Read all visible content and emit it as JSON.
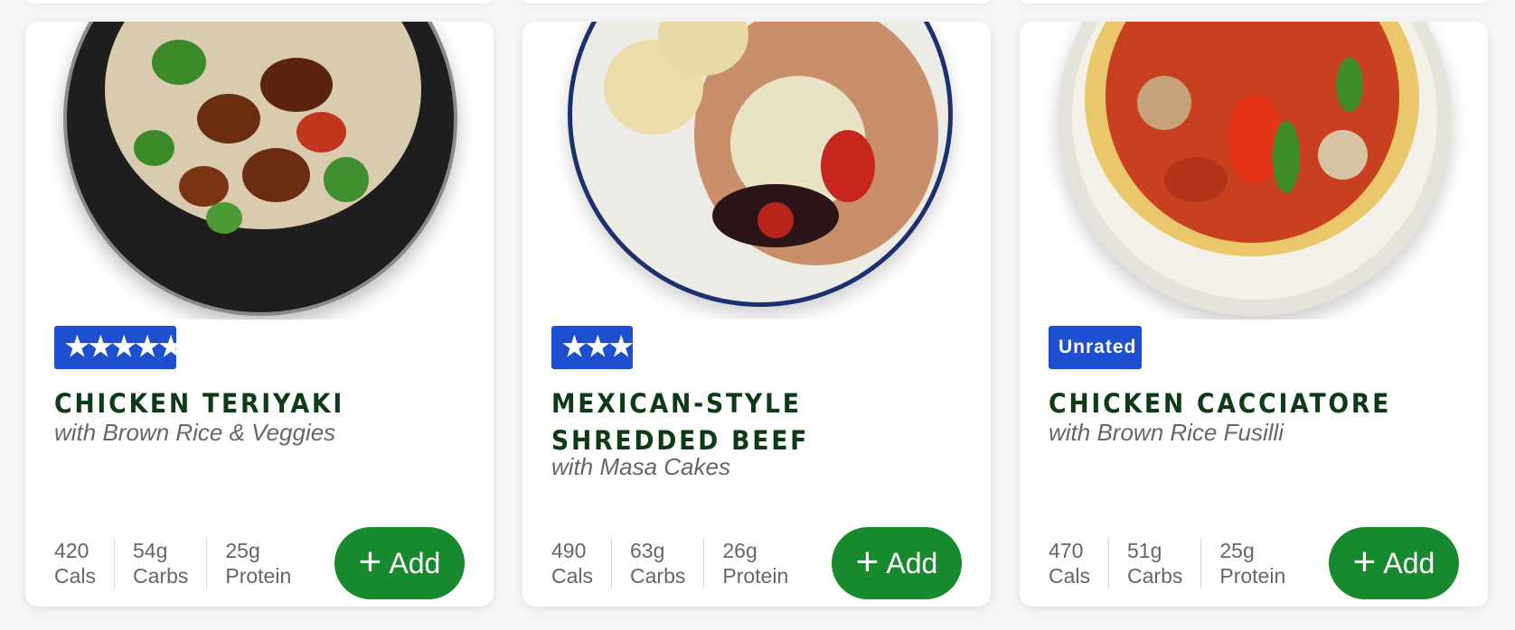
{
  "cards": [
    {
      "rating_stars": "★★★★★",
      "title": "CHICKEN TERIYAKI",
      "subtitle": "with Brown Rice & Veggies",
      "stats": [
        {
          "value": "420",
          "label": "Cals"
        },
        {
          "value": "54g",
          "label": "Carbs"
        },
        {
          "value": "25g",
          "label": "Protein"
        }
      ],
      "add_label": "Add"
    },
    {
      "rating_stars": "★★★",
      "title": "MEXICAN-STYLE SHREDDED BEEF",
      "subtitle": "with Masa Cakes",
      "stats": [
        {
          "value": "490",
          "label": "Cals"
        },
        {
          "value": "63g",
          "label": "Carbs"
        },
        {
          "value": "26g",
          "label": "Protein"
        }
      ],
      "add_label": "Add"
    },
    {
      "rating_text": "Unrated",
      "title": "CHICKEN CACCIATORE",
      "subtitle": "with Brown Rice Fusilli",
      "stats": [
        {
          "value": "470",
          "label": "Cals"
        },
        {
          "value": "51g",
          "label": "Carbs"
        },
        {
          "value": "25g",
          "label": "Protein"
        }
      ],
      "add_label": "Add"
    }
  ],
  "colors": {
    "badge": "#1f4fd1",
    "title": "#0d3b17",
    "add_button": "#178a2e"
  },
  "icons": {
    "add": "plus-icon",
    "rating": "star-icon"
  }
}
